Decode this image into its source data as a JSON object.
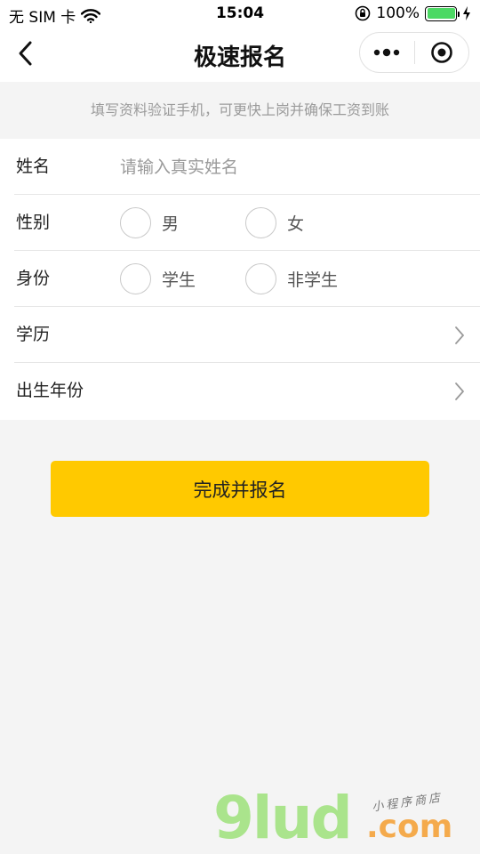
{
  "status": {
    "carrier": "无 SIM 卡",
    "time": "15:04",
    "battery": "100%",
    "battery_level": 1.0
  },
  "nav": {
    "title": "极速报名",
    "back_icon": "chevron-left-icon",
    "more_icon": "more-dots-icon",
    "close_icon": "target-circle-icon"
  },
  "notice": "填写资料验证手机，可更快上岗并确保工资到账",
  "form": {
    "name": {
      "label": "姓名",
      "placeholder": "请输入真实姓名",
      "value": ""
    },
    "gender": {
      "label": "性别",
      "options": [
        "男",
        "女"
      ]
    },
    "identity": {
      "label": "身份",
      "options": [
        "学生",
        "非学生"
      ]
    },
    "education": {
      "label": "学历"
    },
    "birth_year": {
      "label": "出生年份"
    }
  },
  "submit_label": "完成并报名",
  "watermark": {
    "logo": "9lud",
    "suffix": ".com",
    "tagline": "小程序商店"
  },
  "colors": {
    "accent": "#ffc900",
    "battery": "#4cd964",
    "placeholder": "#9a9a9a"
  }
}
